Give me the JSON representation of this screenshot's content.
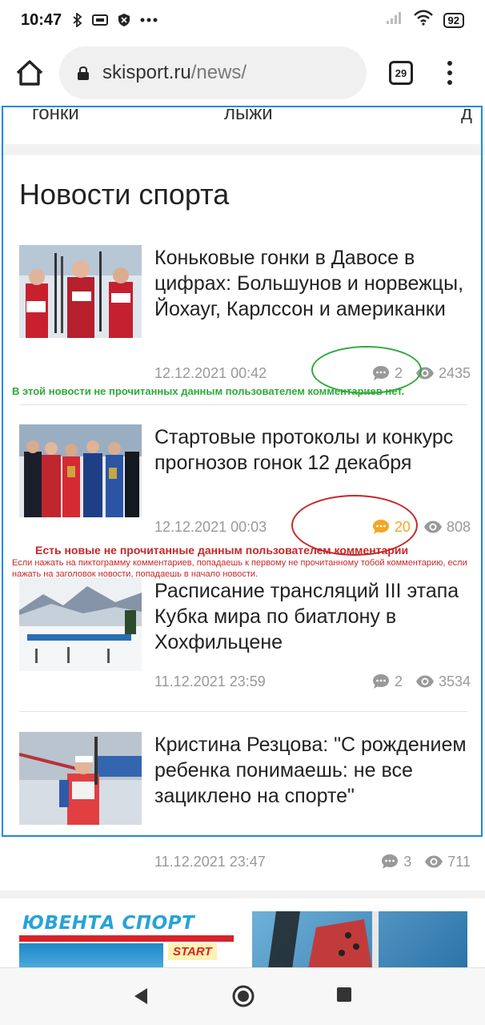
{
  "status_bar": {
    "time": "10:47",
    "battery": "92"
  },
  "browser": {
    "domain": "skisport.ru",
    "path": "/news/",
    "tab_count": "29"
  },
  "categories": [
    "гонки",
    "лыжи",
    "д"
  ],
  "section_title": "Новости спорта",
  "news": [
    {
      "title": "Коньковые гонки в Давосе в цифрах: Большунов и норвежцы, Йохауг, Карлссон и американки",
      "date": "12.12.2021 00:42",
      "comments": "2",
      "views": "2435",
      "has_new": false
    },
    {
      "title": "Стартовые протоколы и конкурс прогнозов гонок 12 декабря",
      "date": "12.12.2021 00:03",
      "comments": "20",
      "views": "808",
      "has_new": true
    },
    {
      "title": "Расписание трансляций III этапа Кубка мира по биатлону в Хохфильцене",
      "date": "11.12.2021 23:59",
      "comments": "2",
      "views": "3534",
      "has_new": false
    },
    {
      "title": "Кристина Резцова: \"С рождением ребенка понимаешь: не все зациклено на спорте\"",
      "date": "11.12.2021 23:47",
      "comments": "3",
      "views": "711",
      "has_new": false
    }
  ],
  "annotations": {
    "green": "В этой новости не прочитанных данным пользователем комментариев нет.",
    "red_main": "Есть новые не прочитанные данным пользователем комментарии",
    "red_sub": "Если нажать на пиктограмму комментариев, попадаешь к первому не прочитанному тобой комментарию, если нажать на заголовок новости, попадаешь в начало новости."
  },
  "banner": {
    "brand": "ЮВЕНТА СПОРТ",
    "start": "START"
  },
  "colors": {
    "accent_new": "#f5a623",
    "meta_gray": "#999999",
    "frame_blue": "#1e88e5",
    "annot_green": "#2eaa3a",
    "annot_red": "#c62828"
  }
}
